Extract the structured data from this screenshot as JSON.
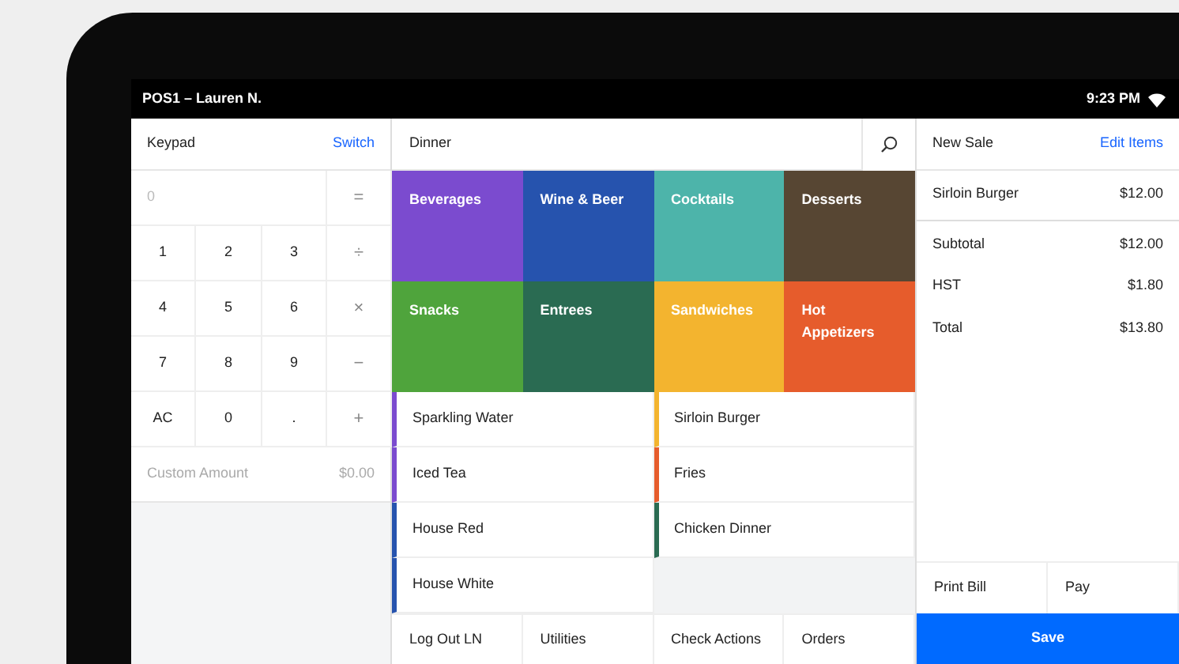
{
  "status_bar": {
    "title": "POS1 – Lauren N.",
    "time": "9:23 PM"
  },
  "keypad": {
    "title": "Keypad",
    "switch_link": "Switch",
    "display": "0",
    "keys": [
      {
        "label": "=",
        "kind": "operator"
      },
      {
        "label": "1",
        "kind": "digit"
      },
      {
        "label": "2",
        "kind": "digit"
      },
      {
        "label": "3",
        "kind": "digit"
      },
      {
        "label": "÷",
        "kind": "operator"
      },
      {
        "label": "4",
        "kind": "digit"
      },
      {
        "label": "5",
        "kind": "digit"
      },
      {
        "label": "6",
        "kind": "digit"
      },
      {
        "label": "×",
        "kind": "operator"
      },
      {
        "label": "7",
        "kind": "digit"
      },
      {
        "label": "8",
        "kind": "digit"
      },
      {
        "label": "9",
        "kind": "digit"
      },
      {
        "label": "−",
        "kind": "operator"
      },
      {
        "label": "AC",
        "kind": "digit"
      },
      {
        "label": "0",
        "kind": "digit"
      },
      {
        "label": ".",
        "kind": "digit"
      },
      {
        "label": "+",
        "kind": "operator"
      }
    ],
    "custom_amount": {
      "label": "Custom Amount",
      "value": "$0.00"
    }
  },
  "menu": {
    "title": "Dinner",
    "categories": [
      {
        "label": "Beverages",
        "color": "#7b4bcf"
      },
      {
        "label": "Wine & Beer",
        "color": "#2653ae"
      },
      {
        "label": "Cocktails",
        "color": "#4db4aa"
      },
      {
        "label": "Desserts",
        "color": "#574633"
      },
      {
        "label": "Snacks",
        "color": "#4fa43c"
      },
      {
        "label": "Entrees",
        "color": "#2a6b52"
      },
      {
        "label": "Sandwiches",
        "color": "#f3b42f"
      },
      {
        "label": "Hot Appetizers",
        "color": "#e65c2c"
      }
    ],
    "items": [
      {
        "name": "Sparkling Water",
        "color": "#7b4bcf"
      },
      {
        "name": "Iced Tea",
        "color": "#7b4bcf"
      },
      {
        "name": "House Red",
        "color": "#2653ae"
      },
      {
        "name": "House White",
        "color": "#2653ae"
      },
      {
        "name": "Sirloin Burger",
        "color": "#f3b42f"
      },
      {
        "name": "Fries",
        "color": "#e65c2c"
      },
      {
        "name": "Chicken Dinner",
        "color": "#2a6b52"
      }
    ],
    "nav": [
      "Log Out LN",
      "Utilities",
      "Check Actions",
      "Orders"
    ]
  },
  "sale": {
    "title": "New Sale",
    "edit_link": "Edit Items",
    "lines": [
      {
        "name": "Sirloin Burger",
        "price": "$12.00"
      }
    ],
    "totals": [
      {
        "label": "Subtotal",
        "value": "$12.00"
      },
      {
        "label": "HST",
        "value": "$1.80"
      },
      {
        "label": "Total",
        "value": "$13.80"
      }
    ],
    "actions": [
      "Print Bill",
      "Pay"
    ],
    "save": "Save"
  }
}
